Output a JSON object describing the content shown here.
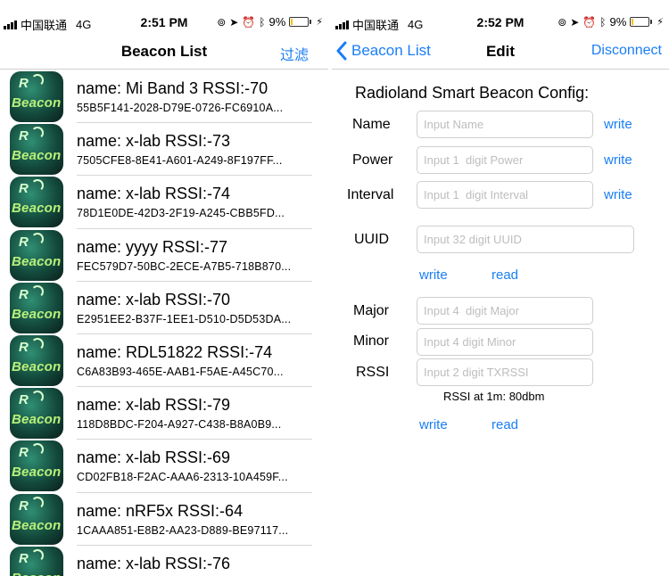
{
  "left_screen": {
    "status": {
      "carrier": "中国联通",
      "network": "4G",
      "time": "2:51 PM",
      "battery": "9%",
      "battery_level": 0.09
    },
    "nav": {
      "title": "Beacon List",
      "right_action": "过滤"
    },
    "beacons": [
      {
        "icon_text_top": "R",
        "icon_text_bottom": "Beacon",
        "name": "Mi Band 3",
        "rssi": "-70",
        "title": "name: Mi Band 3  RSSI:-70",
        "uuid": "55B5F141-2028-D79E-0726-FC6910A..."
      },
      {
        "icon_text_top": "R",
        "icon_text_bottom": "Beacon",
        "name": "x-lab",
        "rssi": "-73",
        "title": "name: x-lab  RSSI:-73",
        "uuid": "7505CFE8-8E41-A601-A249-8F197FF..."
      },
      {
        "icon_text_top": "R",
        "icon_text_bottom": "Beacon",
        "name": "x-lab",
        "rssi": "-74",
        "title": "name: x-lab  RSSI:-74",
        "uuid": "78D1E0DE-42D3-2F19-A245-CBB5FD..."
      },
      {
        "icon_text_top": "R",
        "icon_text_bottom": "Beacon",
        "name": "yyyy",
        "rssi": "-77",
        "title": "name: yyyy  RSSI:-77",
        "uuid": "FEC579D7-50BC-2ECE-A7B5-718B870..."
      },
      {
        "icon_text_top": "R",
        "icon_text_bottom": "Beacon",
        "name": "x-lab",
        "rssi": "-70",
        "title": "name: x-lab  RSSI:-70",
        "uuid": "E2951EE2-B37F-1EE1-D510-D5D53DA..."
      },
      {
        "icon_text_top": "R",
        "icon_text_bottom": "Beacon",
        "name": "RDL51822",
        "rssi": "-74",
        "title": "name: RDL51822  RSSI:-74",
        "uuid": "C6A83B93-465E-AAB1-F5AE-A45C70..."
      },
      {
        "icon_text_top": "R",
        "icon_text_bottom": "Beacon",
        "name": "x-lab",
        "rssi": "-79",
        "title": "name: x-lab  RSSI:-79",
        "uuid": "118D8BDC-F204-A927-C438-B8A0B9..."
      },
      {
        "icon_text_top": "R",
        "icon_text_bottom": "Beacon",
        "name": "x-lab",
        "rssi": "-69",
        "title": "name: x-lab  RSSI:-69",
        "uuid": "CD02FB18-F2AC-AAA6-2313-10A459F..."
      },
      {
        "icon_text_top": "R",
        "icon_text_bottom": "Beacon",
        "name": "nRF5x",
        "rssi": "-64",
        "title": "name: nRF5x  RSSI:-64",
        "uuid": "1CAAA851-E8B2-AA23-D889-BE97117..."
      },
      {
        "icon_text_top": "R",
        "icon_text_bottom": "Beacon",
        "name": "x-lab",
        "rssi": "-76",
        "title": "name: x-lab  RSSI:-76",
        "uuid": ""
      }
    ]
  },
  "right_screen": {
    "status": {
      "carrier": "中国联通",
      "network": "4G",
      "time": "2:52 PM",
      "battery": "9%",
      "battery_level": 0.09
    },
    "nav": {
      "back_label": "Beacon List",
      "title": "Edit",
      "right_action": "Disconnect"
    },
    "config_title": "Radioland Smart Beacon Config:",
    "fields": {
      "name": {
        "label": "Name",
        "placeholder": "Input Name",
        "action": "write"
      },
      "power": {
        "label": "Power",
        "placeholder": "Input 1  digit Power",
        "action": "write"
      },
      "interval": {
        "label": "Interval",
        "placeholder": "Input 1  digit Interval",
        "action": "write"
      },
      "uuid": {
        "label": "UUID",
        "placeholder": "Input 32 digit UUID"
      },
      "major": {
        "label": "Major",
        "placeholder": "Input 4  digit Major"
      },
      "minor": {
        "label": "Minor",
        "placeholder": "Input 4 digit Minor"
      },
      "rssi": {
        "label": "RSSI",
        "placeholder": "Input 2 digit TXRSSI"
      }
    },
    "uuid_actions": {
      "write": "write",
      "read": "read"
    },
    "rssi_note": "RSSI at 1m: 80dbm",
    "bottom_actions": {
      "write": "write",
      "read": "read"
    }
  }
}
